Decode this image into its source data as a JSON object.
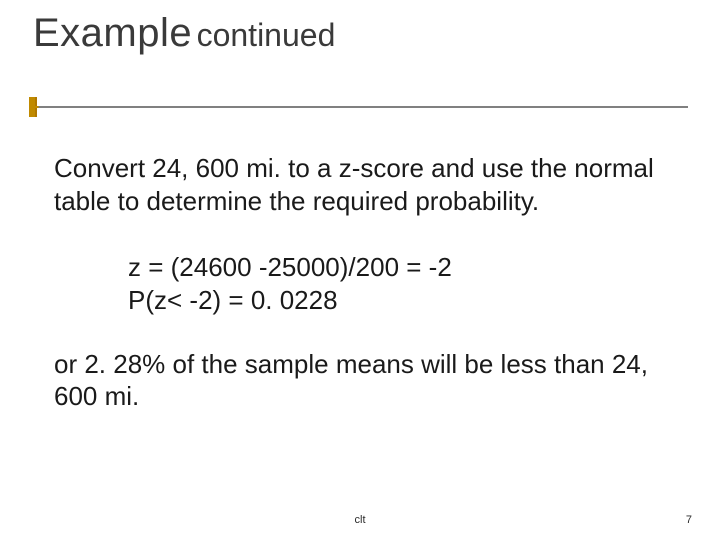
{
  "title": {
    "main": "Example",
    "sub": "continued"
  },
  "body": {
    "para1": "Convert 24, 600 mi. to a z-score and use the normal table to determine the required probability.",
    "calc_line1": "z = (24600 -25000)/200 = -2",
    "calc_line2": "P(z< -2) = 0. 0228",
    "para2": "or 2. 28% of the sample means will be less than 24, 600 mi."
  },
  "footer": {
    "label": "clt",
    "page": "7"
  }
}
